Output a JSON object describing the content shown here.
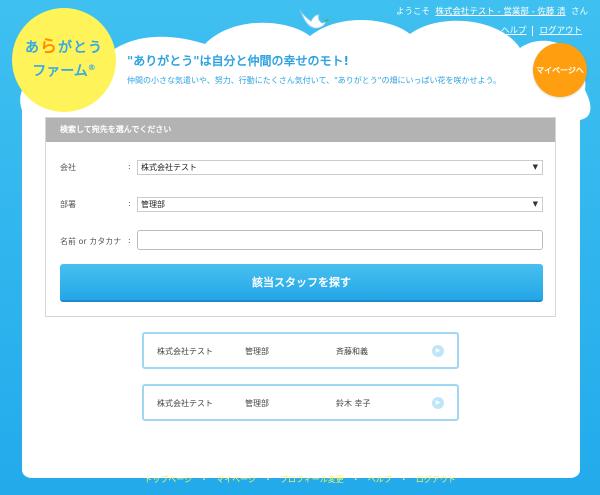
{
  "header": {
    "logo": {
      "line1_a": "あ",
      "line1_ra": "ら",
      "line1_b": "がとう",
      "line2": "ファーム",
      "mark": "®"
    },
    "welcome_prefix": "ようこそ",
    "user_name": "株式会社テスト - 営業部 - 佐藤 清",
    "welcome_suffix": "さん",
    "links": [
      "ヘルプ",
      "ログアウト"
    ],
    "mypage_button": "マイページへ",
    "tagline": "\"ありがとう\"は自分と仲間の幸せのモト!",
    "subline": "仲間の小さな気遣いや、努力、行動にたくさん気付いて、\"ありがとう\"の畑にいっぱい花を咲かせよう。"
  },
  "search_panel": {
    "title": "検索して宛先を選んでください",
    "company": {
      "label": "会社",
      "colon": ":",
      "value": "株式会社テスト"
    },
    "department": {
      "label": "部署",
      "colon": ":",
      "value": "管理部"
    },
    "name": {
      "label": "名前 or カタカナ",
      "colon": ":",
      "value": "",
      "placeholder": ""
    },
    "submit_label": "該当スタッフを探す"
  },
  "results": [
    {
      "company": "株式会社テスト",
      "department": "管理部",
      "name": "斉藤和義"
    },
    {
      "company": "株式会社テスト",
      "department": "管理部",
      "name": "鈴木 幸子"
    }
  ],
  "footer": {
    "links": [
      "トップページ",
      "マイページ",
      "プロフィール変更",
      "ヘルプ",
      "ログアウト"
    ],
    "separator": "・"
  },
  "colors": {
    "sky": "#22aaeb",
    "logo_yellow": "#fff35a",
    "mypage_orange": "#ff9e0f",
    "accent_blue": "#2ea2e0",
    "footer_yellow": "#fff35a"
  },
  "icons": {
    "bird": "dove-icon",
    "select": "triangle-down-icon",
    "go": "play-icon"
  }
}
